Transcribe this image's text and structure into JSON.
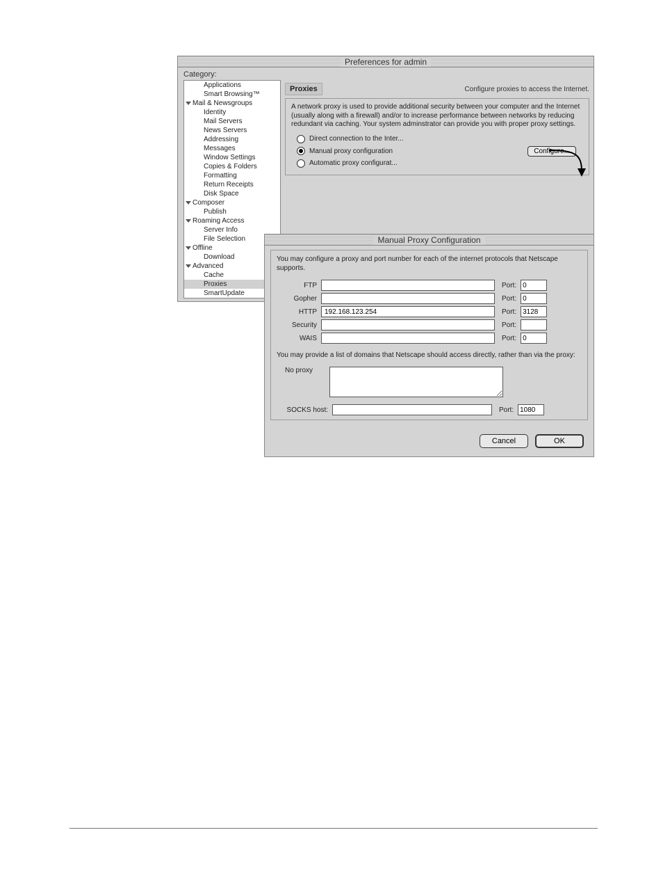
{
  "window": {
    "title": "Preferences for admin",
    "category_label": "Category:"
  },
  "sidebar": {
    "items": [
      {
        "label": "Applications",
        "type": "item"
      },
      {
        "label": "Smart Browsing™",
        "type": "item"
      },
      {
        "label": "Mail & Newsgroups",
        "type": "group"
      },
      {
        "label": "Identity",
        "type": "item"
      },
      {
        "label": "Mail Servers",
        "type": "item"
      },
      {
        "label": "News Servers",
        "type": "item"
      },
      {
        "label": "Addressing",
        "type": "item"
      },
      {
        "label": "Messages",
        "type": "item"
      },
      {
        "label": "Window Settings",
        "type": "item"
      },
      {
        "label": "Copies & Folders",
        "type": "item"
      },
      {
        "label": "Formatting",
        "type": "item"
      },
      {
        "label": "Return Receipts",
        "type": "item"
      },
      {
        "label": "Disk Space",
        "type": "item"
      },
      {
        "label": "Composer",
        "type": "group"
      },
      {
        "label": "Publish",
        "type": "item"
      },
      {
        "label": "Roaming Access",
        "type": "group"
      },
      {
        "label": "Server Info",
        "type": "item"
      },
      {
        "label": "File Selection",
        "type": "item"
      },
      {
        "label": "Offline",
        "type": "group"
      },
      {
        "label": "Download",
        "type": "item"
      },
      {
        "label": "Advanced",
        "type": "group"
      },
      {
        "label": "Cache",
        "type": "item"
      },
      {
        "label": "Proxies",
        "type": "item",
        "selected": true
      },
      {
        "label": "SmartUpdate",
        "type": "item"
      }
    ]
  },
  "panel": {
    "title": "Proxies",
    "subtitle": "Configure proxies to access the Internet.",
    "description": "A network proxy is used to provide additional security between your computer and the Internet (usually along with a firewall) and/or to increase performance between networks by reducing redundant via caching. Your system adminstrator can provide you with proper proxy settings.",
    "radios": {
      "direct": "Direct connection to the Inter...",
      "manual": "Manual proxy configuration",
      "auto": "Automatic proxy configurat..."
    },
    "configure_btn": "Configure..."
  },
  "subwindow": {
    "title": "Manual Proxy Configuration",
    "description": "You may configure a proxy and port number for each of the internet protocols that Netscape supports.",
    "port_label": "Port:",
    "rows": {
      "ftp": {
        "label": "FTP",
        "host": "",
        "port": "0"
      },
      "gopher": {
        "label": "Gopher",
        "host": "",
        "port": "0"
      },
      "http": {
        "label": "HTTP",
        "host": "192.168.123.254",
        "port": "3128"
      },
      "security": {
        "label": "Security",
        "host": "",
        "port": ""
      },
      "wais": {
        "label": "WAIS",
        "host": "",
        "port": "0"
      }
    },
    "noproxy_desc": "You may provide a list of domains that Netscape should access directly, rather than via the proxy:",
    "noproxy_label": "No proxy",
    "socks": {
      "label": "SOCKS host:",
      "host": "",
      "port": "1080",
      "port_label": "Port:"
    },
    "buttons": {
      "cancel": "Cancel",
      "ok": "OK"
    }
  }
}
